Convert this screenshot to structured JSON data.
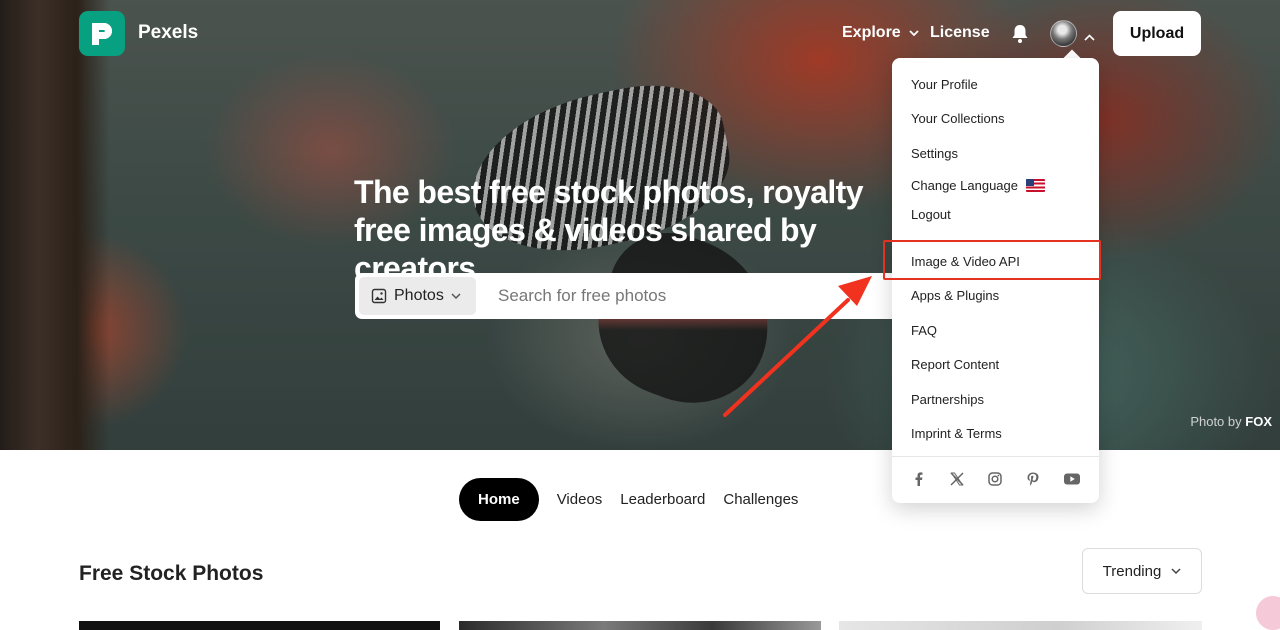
{
  "brand": {
    "name": "Pexels",
    "accent": "#07a081"
  },
  "nav": {
    "explore": "Explore",
    "license": "License",
    "upload": "Upload"
  },
  "hero": {
    "headline": "The best free stock photos, royalty free images & videos shared by creators.",
    "credit_prefix": "Photo by",
    "credit_author": "FOX"
  },
  "search": {
    "type_label": "Photos",
    "placeholder": "Search for free photos"
  },
  "dropdown": {
    "items": [
      "Your Profile",
      "Your Collections",
      "Settings",
      "Change Language",
      "Logout",
      "Image & Video API",
      "Apps & Plugins",
      "FAQ",
      "Report Content",
      "Partnerships",
      "Imprint & Terms"
    ],
    "highlighted_item": "Image & Video API",
    "socials": [
      "facebook-icon",
      "x-icon",
      "instagram-icon",
      "pinterest-icon",
      "youtube-icon"
    ]
  },
  "annotation": {
    "color": "#e53120"
  },
  "tabs": [
    "Home",
    "Videos",
    "Leaderboard",
    "Challenges"
  ],
  "section": {
    "title": "Free Stock Photos",
    "sort_label": "Trending"
  }
}
